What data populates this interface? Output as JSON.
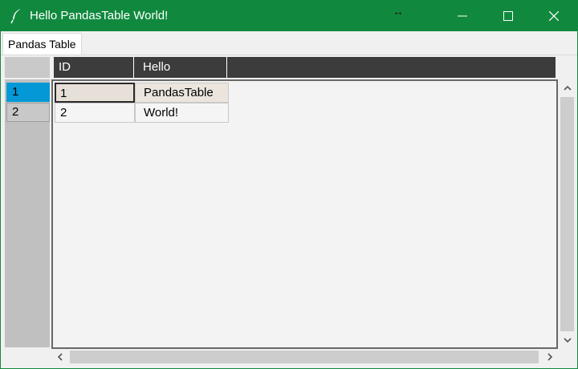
{
  "window": {
    "title": "Hello PandasTable World!",
    "icons": {
      "app": "feather-icon",
      "minimize": "minimize-icon",
      "maximize": "maximize-icon",
      "close": "close-icon",
      "cursor": "horizontal-resize-cursor-icon"
    },
    "titlebar_color": "#10893e"
  },
  "tabs": [
    {
      "label": "Pandas Table",
      "selected": true
    }
  ],
  "table": {
    "columns": [
      "ID",
      "Hello"
    ],
    "row_index": [
      "1",
      "2"
    ],
    "rows": [
      [
        "1",
        "PandasTable"
      ],
      [
        "2",
        "World!"
      ]
    ],
    "selected_row": "1",
    "colors": {
      "header_bg": "#3c3c3c",
      "row_select": "#0499d6",
      "cell_select": "#e6e0d8"
    }
  },
  "scrollbars": {
    "vertical_icons": [
      "chevron-up-icon",
      "chevron-down-icon"
    ],
    "horizontal_icons": [
      "chevron-left-icon",
      "chevron-right-icon"
    ]
  }
}
